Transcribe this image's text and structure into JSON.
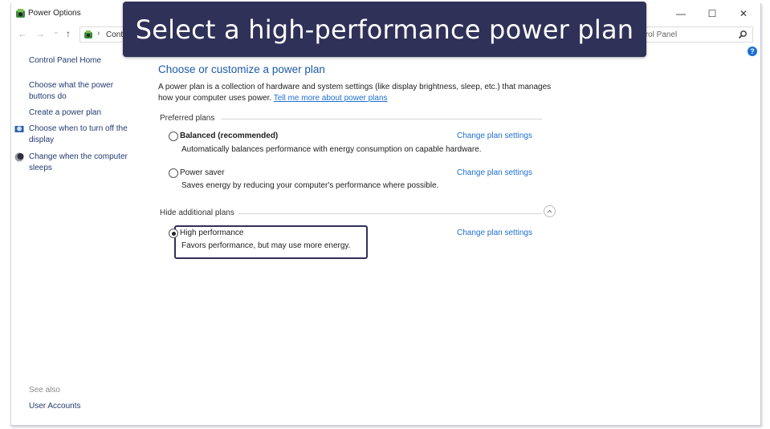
{
  "window": {
    "title": "Power Options",
    "controls": {
      "minimize": "—",
      "maximize": "☐",
      "close": "✕"
    }
  },
  "navbar": {
    "back": "←",
    "forward": "→",
    "recent": "⌄",
    "up": "↑",
    "breadcrumb_sep": "›",
    "address_text": "Control Panel",
    "address_visible": "Cont",
    "search_placeholder": "Search Control Panel",
    "search_visible": "trol Panel"
  },
  "banner": {
    "text": "Select a high-performance power plan"
  },
  "sidebar": {
    "home": "Control Panel Home",
    "items": [
      {
        "label": "Choose what the power buttons do",
        "icon": "none"
      },
      {
        "label": "Create a power plan",
        "icon": "none"
      },
      {
        "label": "Choose when to turn off the display",
        "icon": "monitor-icon"
      },
      {
        "label": "Change when the computer sleeps",
        "icon": "moon-icon"
      }
    ],
    "see_also_label": "See also",
    "see_also_items": [
      "User Accounts"
    ]
  },
  "main": {
    "title": "Choose or customize a power plan",
    "intro": "A power plan is a collection of hardware and system settings (like display brightness, sleep, etc.) that manages how your computer uses power.",
    "intro_link": "Tell me more about power plans",
    "preferred_label": "Preferred plans",
    "additional_label": "Hide additional plans",
    "plans": [
      {
        "name": "Balanced (recommended)",
        "description": "Automatically balances performance with energy consumption on capable hardware.",
        "selected": false,
        "link": "Change plan settings"
      },
      {
        "name": "Power saver",
        "description": "Saves energy by reducing your computer's performance where possible.",
        "selected": false,
        "link": "Change plan settings"
      },
      {
        "name": "High performance",
        "description": "Favors performance, but may use more energy.",
        "selected": true,
        "link": "Change plan settings"
      }
    ]
  },
  "colors": {
    "banner_bg": "#2f3158",
    "link_blue": "#1d6fd0",
    "title_blue": "#1d5aa8",
    "sidebar_link": "#233a70"
  }
}
